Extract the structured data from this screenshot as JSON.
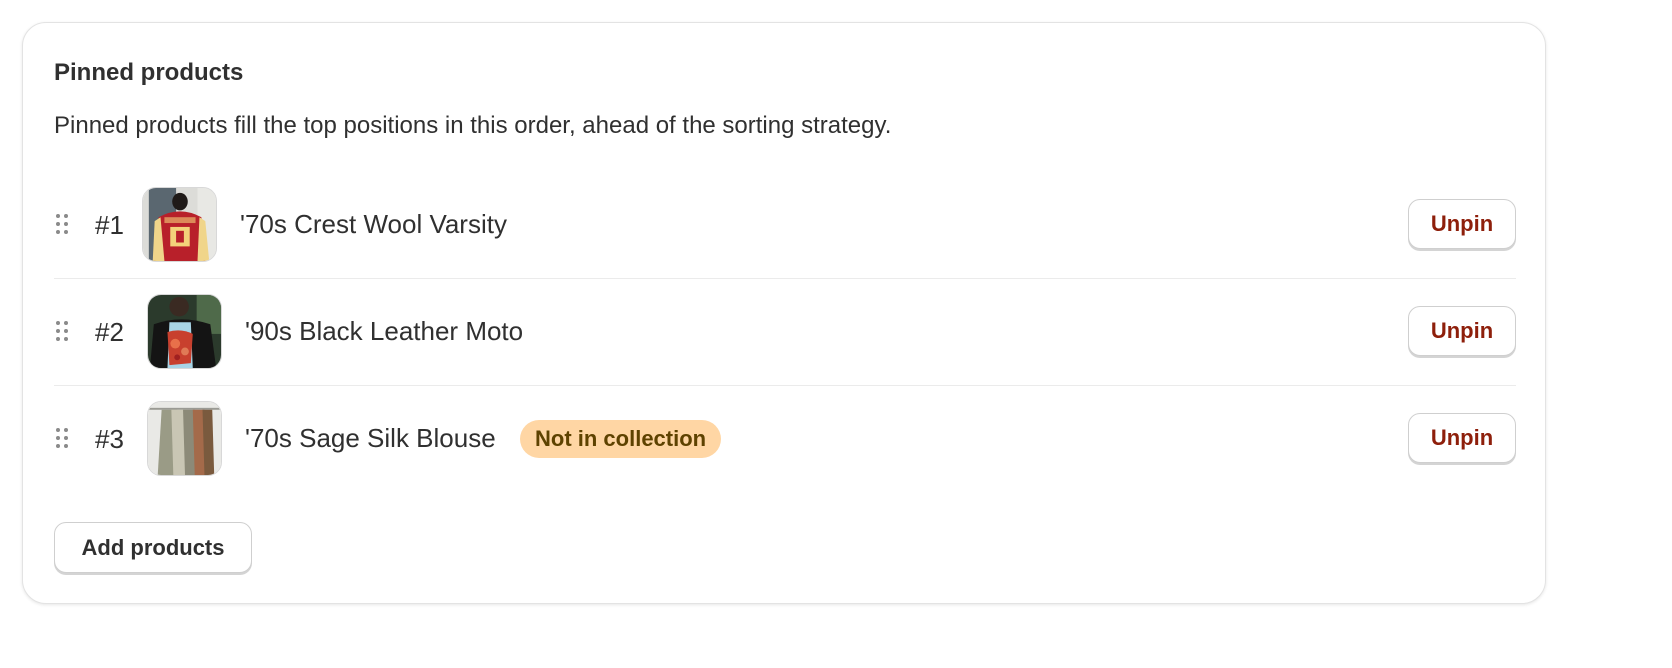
{
  "card": {
    "title": "Pinned products",
    "description": "Pinned products fill the top positions in this order, ahead of the sorting strategy."
  },
  "products": [
    {
      "position": "#1",
      "name": "'70s Crest Wool Varsity",
      "thumbnail": "red-varsity-jacket-photo",
      "action": "Unpin"
    },
    {
      "position": "#2",
      "name": "'90s Black Leather Moto",
      "thumbnail": "black-leather-jacket-photo",
      "action": "Unpin"
    },
    {
      "position": "#3",
      "name": "'70s Sage Silk Blouse",
      "thumbnail": "hanging-blouses-photo",
      "badge": "Not in collection",
      "action": "Unpin"
    }
  ],
  "add_button": "Add products",
  "icons": {
    "drag": "drag-handle-icon"
  },
  "colors": {
    "text": "#303030",
    "unpin_text": "#8e1f0b",
    "badge_bg": "#ffd6a4",
    "badge_text": "#5e4200",
    "border": "#e3e3e3"
  }
}
